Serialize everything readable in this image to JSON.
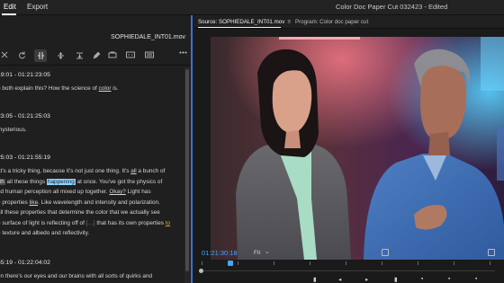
{
  "topbar": {
    "tabs": [
      "Edit",
      "Export"
    ],
    "document_title": "Color Doc Paper Cut 032423 - Edited"
  },
  "transcript_panel": {
    "filename": "SOPHIEDALE_INT01.mov",
    "toolbar_icons": [
      "close-icon",
      "refresh-icon",
      "split-icon",
      "align-vertical-icon",
      "align-horizontal-icon",
      "pen-icon",
      "cut-icon",
      "caption-icon",
      "list-icon",
      "more-icon"
    ],
    "segments": [
      {
        "time": "19:01 - 01:21:23:05",
        "lines": [
          {
            "parts": [
              {
                "t": "u both explain this? How the science of ",
                "s": "n"
              },
              {
                "t": "color",
                "s": "u"
              },
              {
                "t": " is.",
                "s": "n"
              }
            ]
          }
        ]
      },
      {
        "time": "23:05 - 01:21:25:03",
        "lines": [
          {
            "parts": [
              {
                "t": "mysterious.",
                "s": "n"
              }
            ]
          }
        ]
      },
      {
        "time": "25:03 - 01:21:55:19",
        "lines": [
          {
            "parts": [
              {
                "t": "at's a tricky thing, because it's not just one thing. It's ",
                "s": "n"
              },
              {
                "t": "all",
                "s": "u"
              },
              {
                "t": " a bunch of",
                "s": "n"
              }
            ]
          },
          {
            "parts": [
              {
                "t": "ith",
                "s": "sel"
              },
              {
                "t": " all these things ",
                "s": "n"
              },
              {
                "t": "happening",
                "s": "hl"
              },
              {
                "t": " at once. You've got the physics of",
                "s": "n"
              }
            ]
          },
          {
            "parts": [
              {
                "t": "nd human perception all mixed up together. ",
                "s": "n"
              },
              {
                "t": "Okay?",
                "s": "u"
              },
              {
                "t": " Light has",
                "s": "n"
              }
            ]
          },
          {
            "parts": [
              {
                "t": "e properties ",
                "s": "n"
              },
              {
                "t": "like",
                "s": "u"
              },
              {
                "t": ". Like wavelength and intensity and polarization.",
                "s": "n"
              }
            ]
          },
          {
            "parts": [
              {
                "t": "all these properties that determine the color that we actually see",
                "s": "n"
              }
            ]
          },
          {
            "parts": [
              {
                "t": "e surface of light is reflecting off of ",
                "s": "n"
              },
              {
                "t": "[…]",
                "s": "dim"
              },
              {
                "t": " that has its own properties ",
                "s": "n"
              },
              {
                "t": "to",
                "s": "uo"
              }
            ]
          },
          {
            "parts": [
              {
                "t": "e texture and albedo and reflectivity.",
                "s": "n"
              }
            ]
          }
        ]
      },
      {
        "time": "55:19 - 01:22:04:02",
        "lines": [
          {
            "parts": [
              {
                "t": "en there's our eyes and our brains with all sorts of quirks and",
                "s": "n"
              }
            ]
          },
          {
            "parts": [
              {
                "t": "ities. All of these things affect the way we perceive color.",
                "s": "n"
              }
            ]
          }
        ]
      }
    ]
  },
  "monitor": {
    "source_tab": "Source: SOPHIEDALE_INT01.mov",
    "source_menu": "≡",
    "program_tab": "Program: Color doc paper cut",
    "timecode": "01:21:30:18",
    "fit_label": "Fit",
    "accent": "#4aa3ff"
  }
}
